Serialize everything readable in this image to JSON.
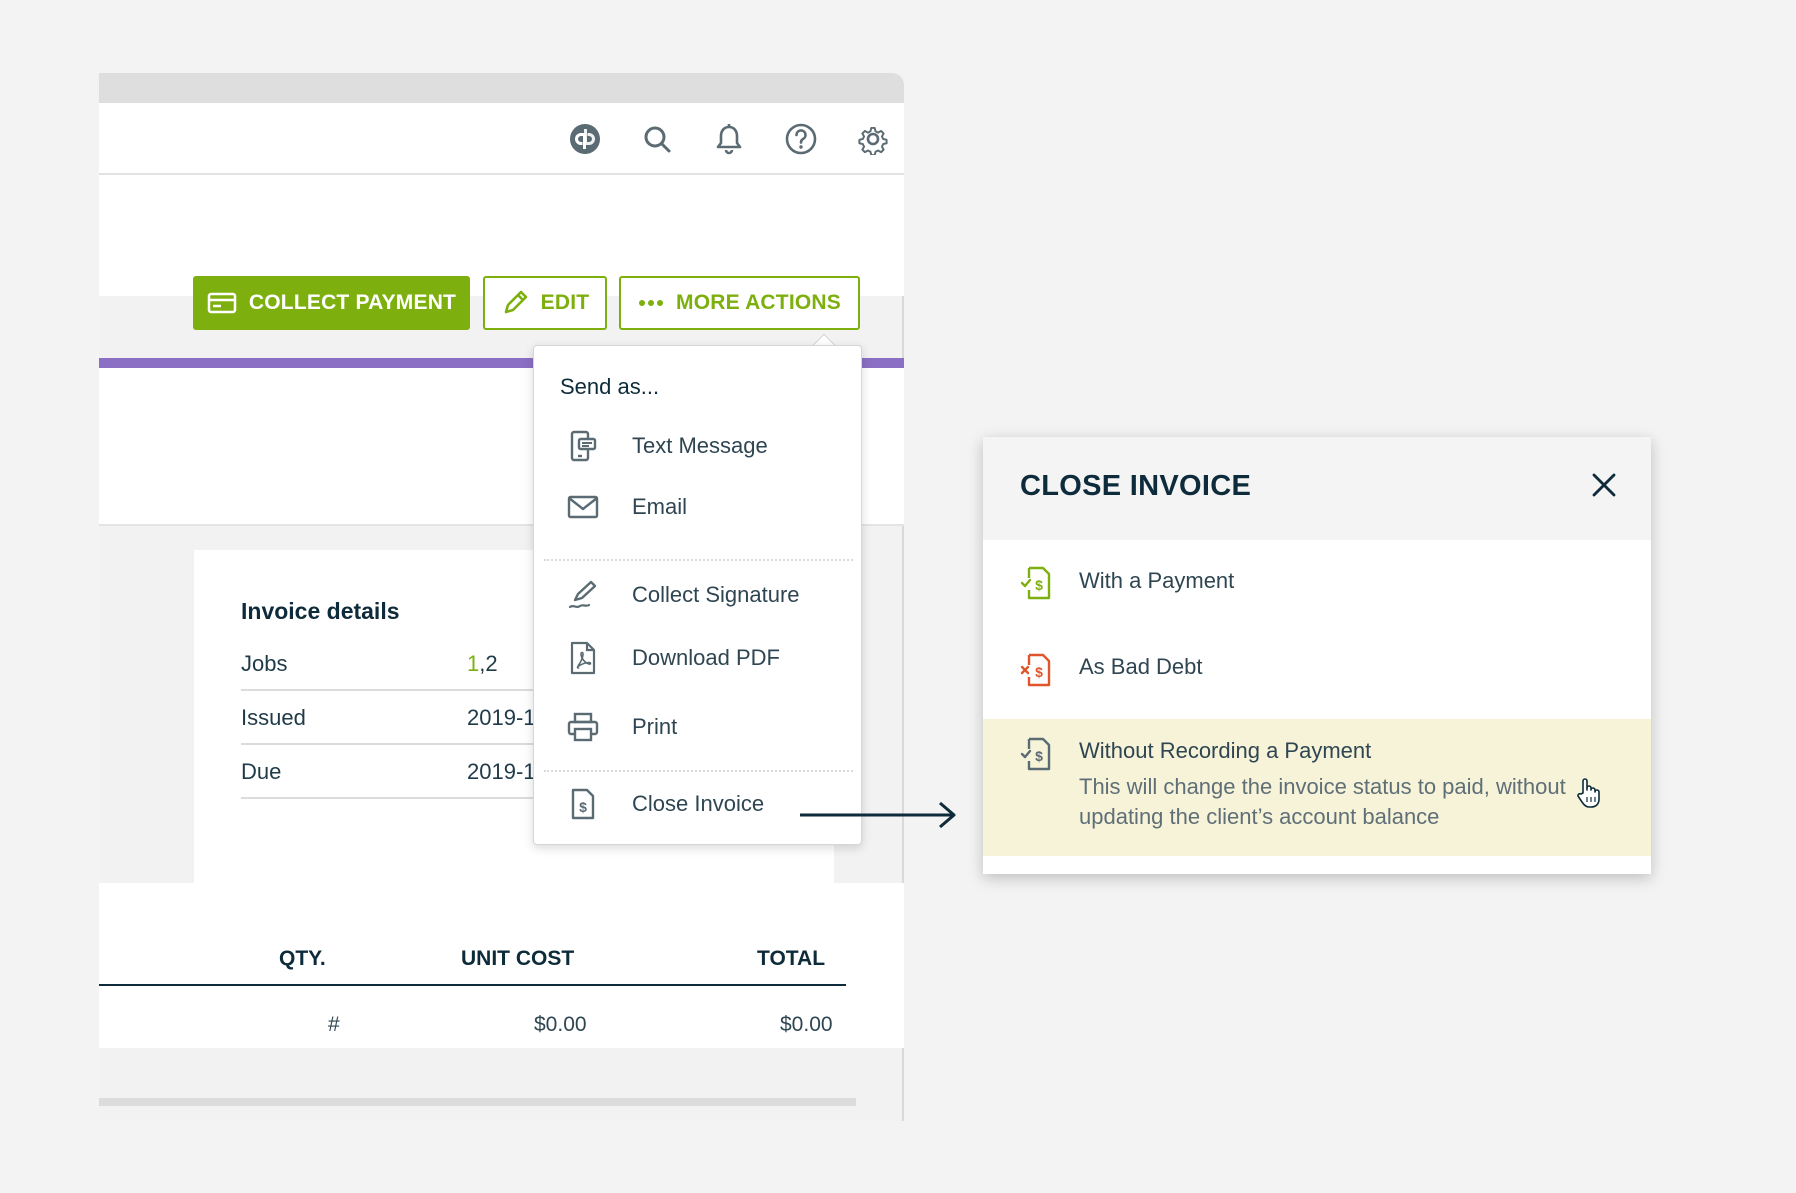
{
  "toolbar": {
    "collect_payment_label": "COLLECT PAYMENT",
    "edit_label": "EDIT",
    "more_actions_label": "MORE ACTIONS",
    "icons": [
      "quickbooks-icon",
      "search-icon",
      "bell-icon",
      "help-icon",
      "gear-icon"
    ]
  },
  "invoice_details": {
    "title": "Invoice details",
    "rows": [
      {
        "label": "Jobs",
        "value_link": "1",
        "value_rest": ",2"
      },
      {
        "label": "Issued",
        "value": "2019-1"
      },
      {
        "label": "Due",
        "value": "2019-1"
      }
    ]
  },
  "line_items": {
    "headers": [
      "QTY.",
      "UNIT COST",
      "TOTAL"
    ],
    "row": {
      "qty": "#",
      "unit_cost": "$0.00",
      "total": "$0.00"
    }
  },
  "more_actions_menu": {
    "heading": "Send as...",
    "items": [
      {
        "label": "Text Message",
        "icon": "text-message-icon"
      },
      {
        "label": "Email",
        "icon": "email-icon"
      },
      {
        "label": "Collect Signature",
        "icon": "signature-icon"
      },
      {
        "label": "Download PDF",
        "icon": "pdf-icon"
      },
      {
        "label": "Print",
        "icon": "printer-icon"
      },
      {
        "label": "Close Invoice",
        "icon": "invoice-icon"
      }
    ]
  },
  "close_invoice_modal": {
    "title": "CLOSE INVOICE",
    "options": [
      {
        "label": "With a Payment",
        "icon": "invoice-paid-icon"
      },
      {
        "label": "As Bad Debt",
        "icon": "invoice-bad-debt-icon"
      },
      {
        "label": "Without Recording a Payment",
        "icon": "invoice-icon",
        "description": "This will change the invoice status to paid, without updating the client’s account balance"
      }
    ]
  },
  "colors": {
    "primary_green": "#7db00e",
    "accent_purple": "#8a6fc4",
    "navy": "#0d2b3a",
    "bad_debt_red": "#e0552b",
    "highlight": "#f6f3d8"
  }
}
